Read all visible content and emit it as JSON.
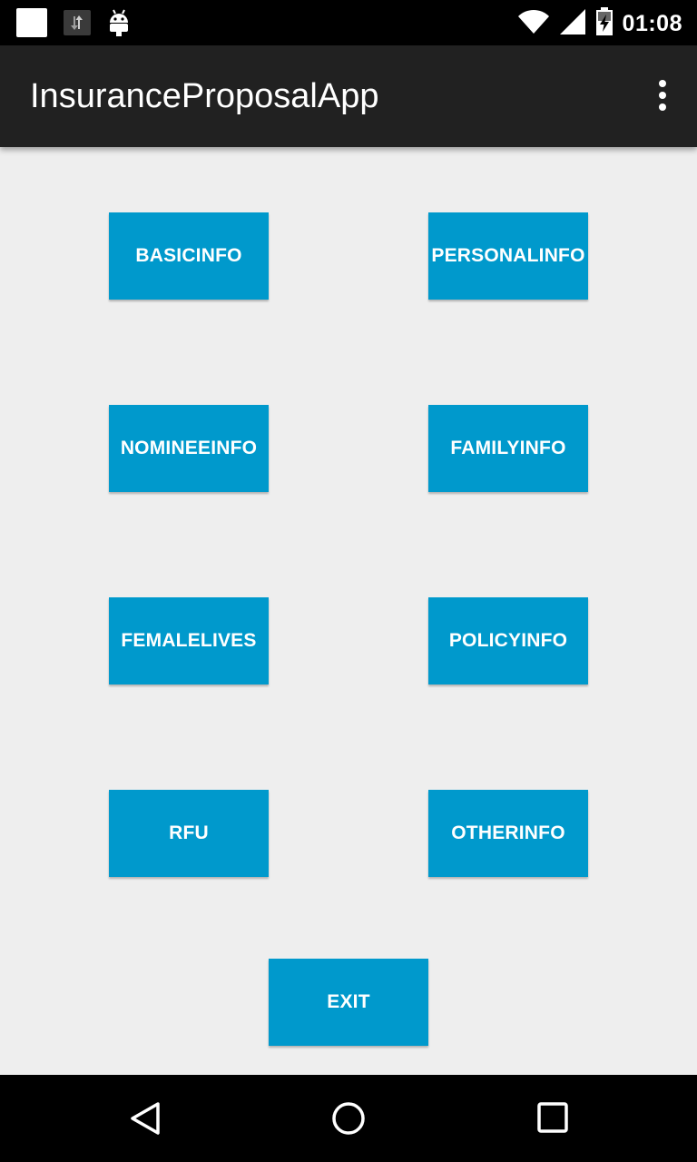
{
  "status_bar": {
    "time": "01:08",
    "icons": [
      "notification-square-icon",
      "download-icon",
      "android-debug-icon",
      "wifi-icon",
      "signal-icon",
      "battery-charging-icon"
    ]
  },
  "app": {
    "title": "InsuranceProposalApp",
    "overflow_icon": "overflow-menu-icon"
  },
  "buttons": {
    "basicinfo": "BASICINFO",
    "personalinfo": "PERSONALINFO",
    "nomineeinfo": "NOMINEEINFO",
    "familyinfo": "FAMILYINFO",
    "femalelives": "FEMALELIVES",
    "policyinfo": "POLICYINFO",
    "rfu": "RFU",
    "otherinfo": "OTHERINFO",
    "exit": "EXIT"
  },
  "colors": {
    "accent": "#0099cc",
    "action_bar": "#212121",
    "background": "#eeeeee"
  },
  "nav_bar": {
    "icons": [
      "back-icon",
      "home-icon",
      "recents-icon"
    ]
  }
}
